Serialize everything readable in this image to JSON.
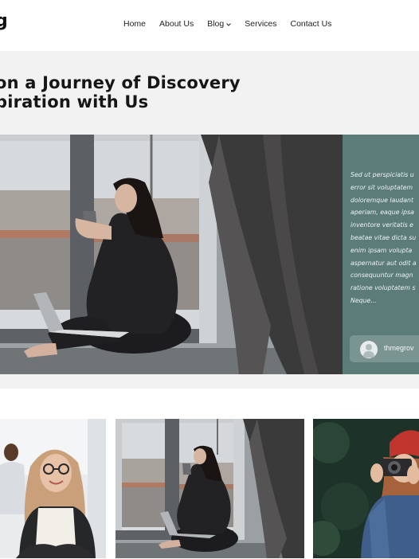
{
  "header": {
    "logo_text": "g",
    "logo_sub": "",
    "nav": [
      {
        "label": "Home"
      },
      {
        "label": "About Us"
      },
      {
        "label": "Blog"
      },
      {
        "label": "Services"
      },
      {
        "label": "Contact Us"
      }
    ],
    "nav_dropdown_icon": "chevron-down-icon"
  },
  "hero": {
    "title_line1": "on a Journey of Discovery",
    "title_line2": "piration with Us",
    "excerpt": "Sed ut perspiciatis u\nerror sit voluptatem\ndoloremque laudant\naperiam, eaque ipsa\ninventore veritatis e\nbeatae vitae dicta su\nenim ipsam volupta\naspernatur aut odit a\nconsequuntur magn\nratione voluptatem s\nNeque...",
    "author": "thmegrov",
    "panel_color": "#5c7c7a"
  },
  "cards": [
    {
      "image": "woman-glasses-office-photo"
    },
    {
      "image": "woman-window-laptop-photo"
    },
    {
      "image": "woman-camera-red-hat-photo"
    }
  ]
}
